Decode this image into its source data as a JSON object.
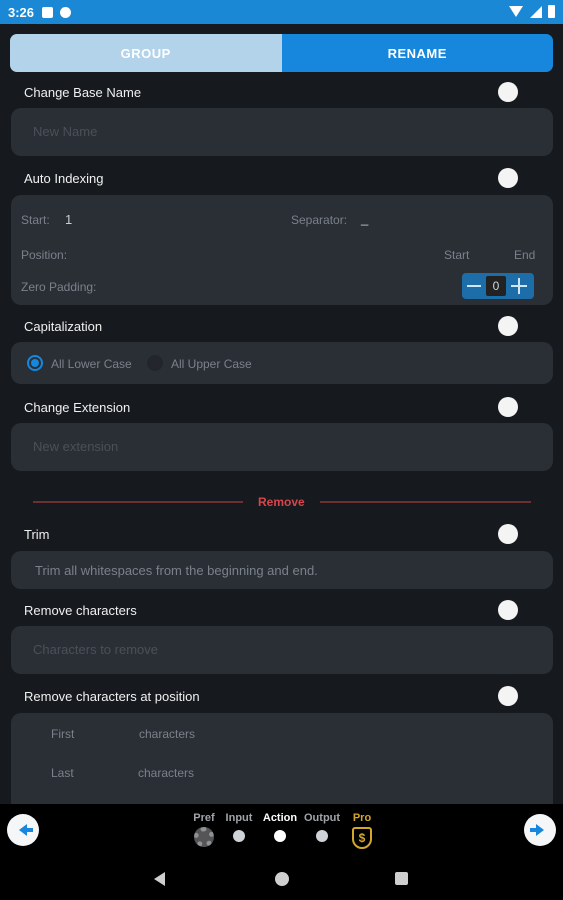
{
  "status_bar": {
    "time": "3:26"
  },
  "tabs": {
    "group": "GROUP",
    "rename": "RENAME"
  },
  "base_name": {
    "title": "Change Base Name",
    "placeholder": "New Name"
  },
  "auto_indexing": {
    "title": "Auto Indexing",
    "start_label": "Start:",
    "start_value": "1",
    "separator_label": "Separator:",
    "separator_value": "_",
    "position_label": "Position:",
    "position_start": "Start",
    "position_end": "End",
    "zero_padding_label": "Zero Padding:",
    "zero_padding_value": "0"
  },
  "capitalization": {
    "title": "Capitalization",
    "option_lower": "All Lower Case",
    "option_upper": "All Upper Case",
    "selected": "All Lower Case"
  },
  "extension": {
    "title": "Change Extension",
    "placeholder": "New extension"
  },
  "remove_divider": "Remove",
  "trim": {
    "title": "Trim",
    "description": "Trim all whitespaces from the beginning and end."
  },
  "remove_characters": {
    "title": "Remove characters",
    "placeholder": "Characters to remove"
  },
  "remove_at_position": {
    "title": "Remove characters at position",
    "first_label": "First",
    "last_label": "Last",
    "unit_first": "characters",
    "unit_last": "characters"
  },
  "bottom_nav": {
    "steps": [
      {
        "label": "Pref",
        "icon": "gear-icon"
      },
      {
        "label": "Input",
        "icon": "dot"
      },
      {
        "label": "Action",
        "icon": "dot",
        "active": true
      },
      {
        "label": "Output",
        "icon": "dot"
      },
      {
        "label": "Pro",
        "icon": "dollar-shield-icon"
      }
    ]
  },
  "colors": {
    "accent": "#1687dc",
    "card": "#2a2f36",
    "background": "#16191e",
    "danger": "#d5464a",
    "pro": "#d4a72c"
  }
}
